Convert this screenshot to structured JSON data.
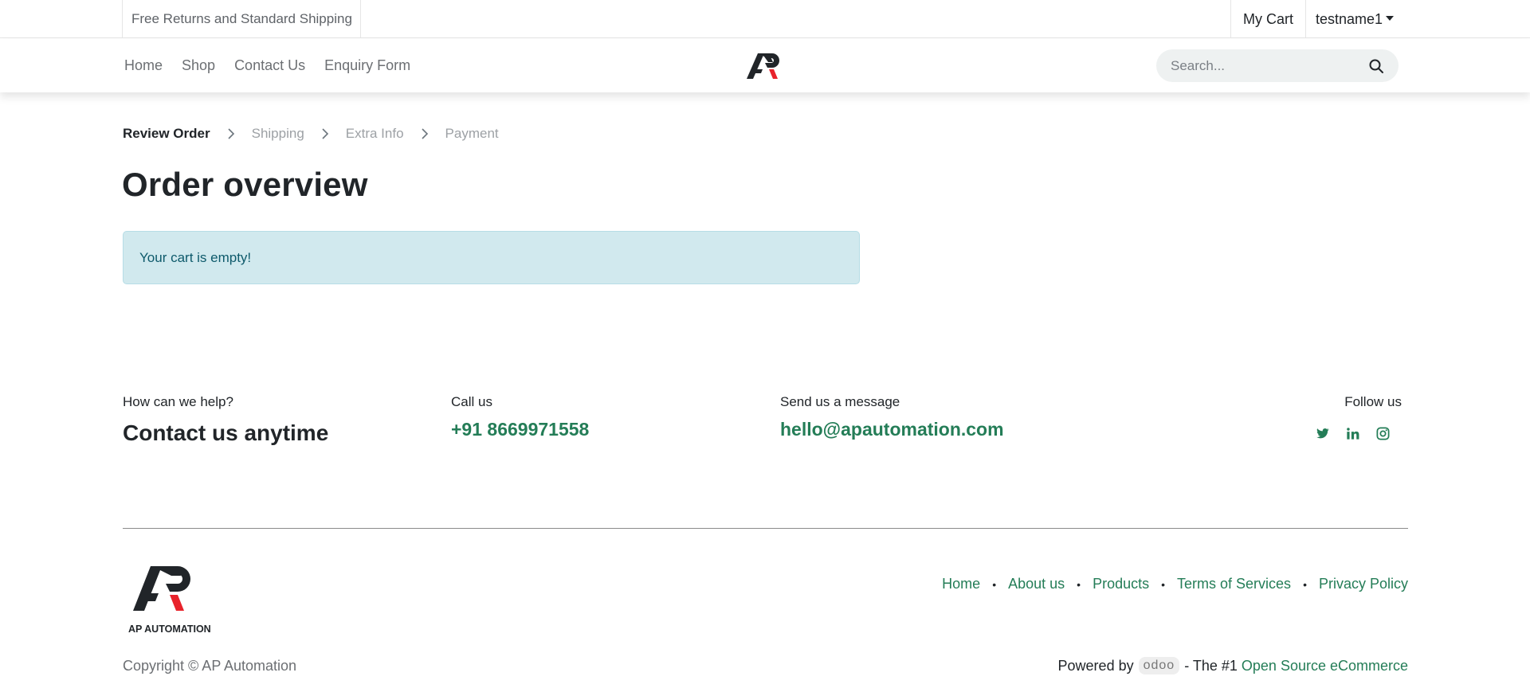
{
  "topbar": {
    "promo": "Free Returns and Standard Shipping",
    "my_cart": "My Cart",
    "user": "testname1"
  },
  "nav": {
    "links": [
      "Home",
      "Shop",
      "Contact Us",
      "Enquiry Form"
    ],
    "search_placeholder": "Search..."
  },
  "breadcrumb": {
    "steps": [
      "Review Order",
      "Shipping",
      "Extra Info",
      "Payment"
    ],
    "active_index": 0
  },
  "page_title": "Order overview",
  "alert": "Your cart is empty!",
  "contact": {
    "help_small": "How can we help?",
    "help_big": "Contact us anytime",
    "call_small": "Call us",
    "phone": "+91 8669971558",
    "message_small": "Send us a message",
    "email": "hello@apautomation.com",
    "follow": "Follow us",
    "socials": [
      "twitter-icon",
      "linkedin-icon",
      "instagram-icon"
    ]
  },
  "footer": {
    "logo_text": "AP AUTOMATION",
    "links": [
      "Home",
      "About us",
      "Products",
      "Terms of Services",
      "Privacy Policy"
    ],
    "copyright": "Copyright © AP Automation",
    "powered_by": "Powered by",
    "odoo": "odoo",
    "tagline": "- The #1",
    "tagline_link": "Open Source eCommerce"
  },
  "colors": {
    "accent": "#247d57",
    "alert_bg": "#d1e9ee",
    "logo_red": "#e8232b"
  }
}
